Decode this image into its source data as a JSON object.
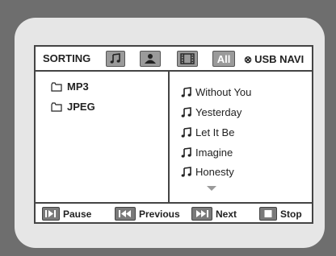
{
  "header": {
    "sorting_label": "SORTING",
    "all_label": "All",
    "usb_navi_label": "USB NAVI",
    "tabs": [
      {
        "icon": "music-note-icon"
      },
      {
        "icon": "person-icon"
      },
      {
        "icon": "film-icon"
      },
      {
        "icon": "all-label"
      }
    ]
  },
  "folders": [
    {
      "name": "MP3",
      "icon": "folder-icon"
    },
    {
      "name": "JPEG",
      "icon": "folder-icon"
    }
  ],
  "songs": [
    {
      "title": "Without You",
      "icon": "music-note-icon"
    },
    {
      "title": "Yesterday",
      "icon": "music-note-icon"
    },
    {
      "title": "Let It Be",
      "icon": "music-note-icon"
    },
    {
      "title": "Imagine",
      "icon": "music-note-icon"
    },
    {
      "title": "Honesty",
      "icon": "music-note-icon"
    }
  ],
  "controls": {
    "pause": "Pause",
    "previous": "Previous",
    "next": "Next",
    "stop": "Stop"
  },
  "colors": {
    "outer_bg": "#6e6e6e",
    "bezel": "#e6e6e6",
    "screen_bg": "#ffffff",
    "button_gray": "#9a9a9a"
  }
}
